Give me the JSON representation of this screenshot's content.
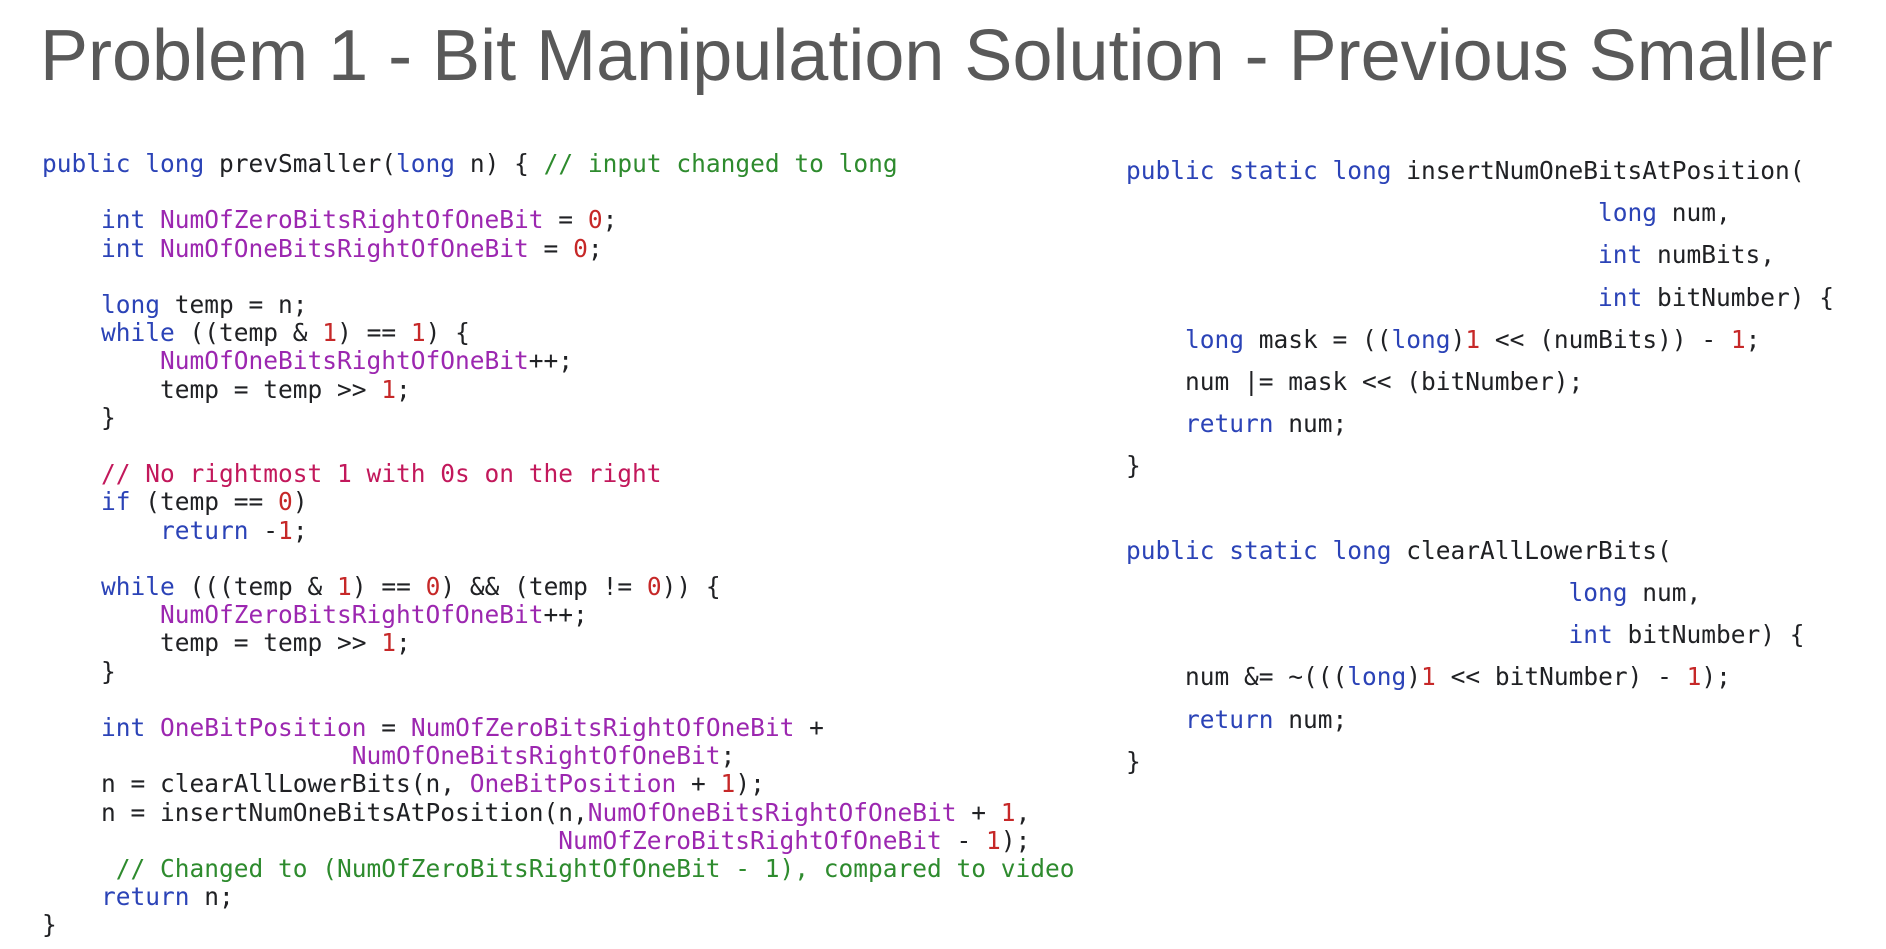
{
  "slide": {
    "title": "Problem 1 - Bit Manipulation Solution - Previous Smaller"
  },
  "colors": {
    "title": "#595959",
    "keyword": "#2b43b7",
    "variable": "#9c27b0",
    "number": "#c62828",
    "comment_green": "#2e8b2e",
    "comment_red": "#c2185b",
    "plain": "#202124"
  },
  "code_left": {
    "lines": [
      [
        [
          "kw",
          "public "
        ],
        [
          "ty",
          "long "
        ],
        [
          "p",
          "prevSmaller("
        ],
        [
          "ty",
          "long "
        ],
        [
          "p",
          "n) { "
        ],
        [
          "cg",
          "// input changed to long"
        ]
      ],
      [],
      [
        [
          "p",
          "    "
        ],
        [
          "ty",
          "int "
        ],
        [
          "v",
          "NumOfZeroBitsRightOfOneBit"
        ],
        [
          "p",
          " = "
        ],
        [
          "n",
          "0"
        ],
        [
          "p",
          ";"
        ]
      ],
      [
        [
          "p",
          "    "
        ],
        [
          "ty",
          "int "
        ],
        [
          "v",
          "NumOfOneBitsRightOfOneBit"
        ],
        [
          "p",
          " = "
        ],
        [
          "n",
          "0"
        ],
        [
          "p",
          ";"
        ]
      ],
      [],
      [
        [
          "p",
          "    "
        ],
        [
          "ty",
          "long "
        ],
        [
          "p",
          "temp = n;"
        ]
      ],
      [
        [
          "p",
          "    "
        ],
        [
          "kw",
          "while "
        ],
        [
          "p",
          "((temp & "
        ],
        [
          "n",
          "1"
        ],
        [
          "p",
          ") == "
        ],
        [
          "n",
          "1"
        ],
        [
          "p",
          ") {"
        ]
      ],
      [
        [
          "p",
          "        "
        ],
        [
          "v",
          "NumOfOneBitsRightOfOneBit"
        ],
        [
          "p",
          "++;"
        ]
      ],
      [
        [
          "p",
          "        temp = temp >> "
        ],
        [
          "n",
          "1"
        ],
        [
          "p",
          ";"
        ]
      ],
      [
        [
          "p",
          "    }"
        ]
      ],
      [],
      [
        [
          "p",
          "    "
        ],
        [
          "cr",
          "// No rightmost 1 with 0s on the right"
        ]
      ],
      [
        [
          "p",
          "    "
        ],
        [
          "kw",
          "if "
        ],
        [
          "p",
          "(temp == "
        ],
        [
          "n",
          "0"
        ],
        [
          "p",
          ")"
        ]
      ],
      [
        [
          "p",
          "        "
        ],
        [
          "kw",
          "return "
        ],
        [
          "p",
          "-"
        ],
        [
          "n",
          "1"
        ],
        [
          "p",
          ";"
        ]
      ],
      [],
      [
        [
          "p",
          "    "
        ],
        [
          "kw",
          "while "
        ],
        [
          "p",
          "(((temp & "
        ],
        [
          "n",
          "1"
        ],
        [
          "p",
          ") == "
        ],
        [
          "n",
          "0"
        ],
        [
          "p",
          ") && (temp != "
        ],
        [
          "n",
          "0"
        ],
        [
          "p",
          ")) {"
        ]
      ],
      [
        [
          "p",
          "        "
        ],
        [
          "v",
          "NumOfZeroBitsRightOfOneBit"
        ],
        [
          "p",
          "++;"
        ]
      ],
      [
        [
          "p",
          "        temp = temp >> "
        ],
        [
          "n",
          "1"
        ],
        [
          "p",
          ";"
        ]
      ],
      [
        [
          "p",
          "    }"
        ]
      ],
      [],
      [
        [
          "p",
          "    "
        ],
        [
          "ty",
          "int "
        ],
        [
          "v",
          "OneBitPosition"
        ],
        [
          "p",
          " = "
        ],
        [
          "v",
          "NumOfZeroBitsRightOfOneBit"
        ],
        [
          "p",
          " +"
        ]
      ],
      [
        [
          "p",
          "                     "
        ],
        [
          "v",
          "NumOfOneBitsRightOfOneBit"
        ],
        [
          "p",
          ";"
        ]
      ],
      [
        [
          "p",
          "    n = clearAllLowerBits(n, "
        ],
        [
          "v",
          "OneBitPosition"
        ],
        [
          "p",
          " + "
        ],
        [
          "n",
          "1"
        ],
        [
          "p",
          ");"
        ]
      ],
      [
        [
          "p",
          "    n = insertNumOneBitsAtPosition(n,"
        ],
        [
          "v",
          "NumOfOneBitsRightOfOneBit"
        ],
        [
          "p",
          " + "
        ],
        [
          "n",
          "1"
        ],
        [
          "p",
          ","
        ]
      ],
      [
        [
          "p",
          "                                   "
        ],
        [
          "v",
          "NumOfZeroBitsRightOfOneBit"
        ],
        [
          "p",
          " - "
        ],
        [
          "n",
          "1"
        ],
        [
          "p",
          ");"
        ]
      ],
      [
        [
          "p",
          "     "
        ],
        [
          "cg",
          "// Changed to (NumOfZeroBitsRightOfOneBit - 1), compared to video"
        ]
      ],
      [
        [
          "p",
          "    "
        ],
        [
          "kw",
          "return "
        ],
        [
          "p",
          "n;"
        ]
      ],
      [
        [
          "p",
          "}"
        ]
      ]
    ]
  },
  "code_right": {
    "lines": [
      [
        [
          "kw",
          "public static "
        ],
        [
          "ty",
          "long "
        ],
        [
          "p",
          "insertNumOneBitsAtPosition("
        ]
      ],
      [
        [
          "p",
          "                                "
        ],
        [
          "ty",
          "long "
        ],
        [
          "p",
          "num,"
        ]
      ],
      [
        [
          "p",
          "                                "
        ],
        [
          "ty",
          "int "
        ],
        [
          "p",
          "numBits,"
        ]
      ],
      [
        [
          "p",
          "                                "
        ],
        [
          "ty",
          "int "
        ],
        [
          "p",
          "bitNumber) {"
        ]
      ],
      [
        [
          "p",
          "    "
        ],
        [
          "ty",
          "long "
        ],
        [
          "p",
          "mask = (("
        ],
        [
          "ty",
          "long"
        ],
        [
          "p",
          ")"
        ],
        [
          "n",
          "1"
        ],
        [
          "p",
          " << (numBits)) - "
        ],
        [
          "n",
          "1"
        ],
        [
          "p",
          ";"
        ]
      ],
      [
        [
          "p",
          "    num |= mask << (bitNumber);"
        ]
      ],
      [
        [
          "p",
          "    "
        ],
        [
          "kw",
          "return "
        ],
        [
          "p",
          "num;"
        ]
      ],
      [
        [
          "p",
          "}"
        ]
      ],
      [],
      [
        [
          "kw",
          "public static "
        ],
        [
          "ty",
          "long "
        ],
        [
          "p",
          "clearAllLowerBits("
        ]
      ],
      [
        [
          "p",
          "                              "
        ],
        [
          "ty",
          "long "
        ],
        [
          "p",
          "num,"
        ]
      ],
      [
        [
          "p",
          "                              "
        ],
        [
          "ty",
          "int "
        ],
        [
          "p",
          "bitNumber) {"
        ]
      ],
      [
        [
          "p",
          "    num &= ~((("
        ],
        [
          "ty",
          "long"
        ],
        [
          "p",
          ")"
        ],
        [
          "n",
          "1"
        ],
        [
          "p",
          " << bitNumber) - "
        ],
        [
          "n",
          "1"
        ],
        [
          "p",
          ");"
        ]
      ],
      [
        [
          "p",
          "    "
        ],
        [
          "kw",
          "return "
        ],
        [
          "p",
          "num;"
        ]
      ],
      [
        [
          "p",
          "}"
        ]
      ]
    ]
  }
}
